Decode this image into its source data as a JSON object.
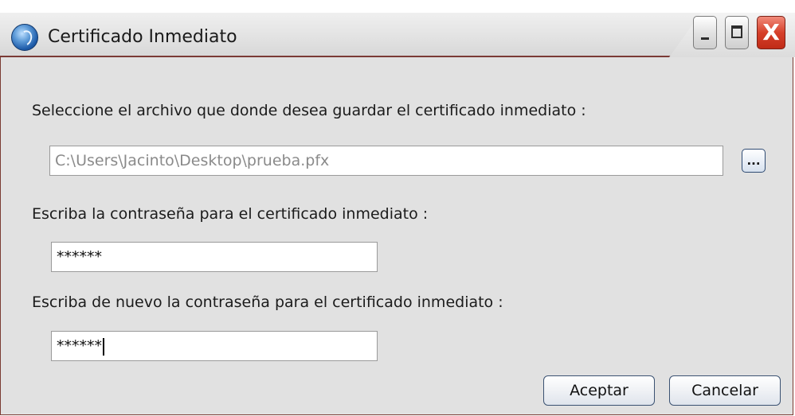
{
  "window": {
    "title": "Certificado Inmediato",
    "controls": {
      "minimize_icon": "minimize-icon",
      "maximize_icon": "maximize-icon",
      "close_glyph": "X"
    }
  },
  "form": {
    "file_label": "Seleccione el archivo que donde desea guardar el certificado inmediato :",
    "file_value": "C:\\Users\\Jacinto\\Desktop\\prueba.pfx",
    "browse_label": "...",
    "password_label": "Escriba la contraseña para el certificado inmediato :",
    "password_value": "******",
    "confirm_label": "Escriba de nuevo la contraseña para el certificado inmediato :",
    "confirm_value": "******"
  },
  "buttons": {
    "accept": "Aceptar",
    "cancel": "Cancelar"
  },
  "colors": {
    "window_border": "#7b3a35",
    "close_button": "#d6402a",
    "background": "#e1e1e1"
  }
}
